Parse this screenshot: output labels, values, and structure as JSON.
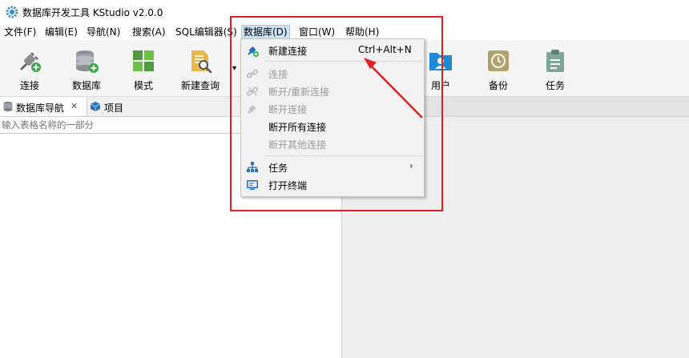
{
  "window": {
    "title": "数据库开发工具 KStudio v2.0.0"
  },
  "menubar": {
    "items": [
      {
        "label": "文件(F)"
      },
      {
        "label": "编辑(E)"
      },
      {
        "label": "导航(N)"
      },
      {
        "label": "搜索(A)"
      },
      {
        "label": "SQL编辑器(S)"
      },
      {
        "label": "数据库(D)"
      },
      {
        "label": "窗口(W)"
      },
      {
        "label": "帮助(H)"
      }
    ],
    "active_index": 5
  },
  "toolbar": {
    "items": [
      {
        "label": "连接",
        "icon": "plug-add-icon"
      },
      {
        "label": "数据库",
        "icon": "database-add-icon"
      },
      {
        "label": "模式",
        "icon": "schema-blocks-icon"
      },
      {
        "label": "新建查询",
        "icon": "new-query-icon"
      },
      {
        "label": "用户",
        "icon": "user-folder-icon"
      },
      {
        "label": "备份",
        "icon": "backup-clock-icon"
      },
      {
        "label": "任务",
        "icon": "task-clipboard-icon"
      }
    ],
    "more_arrow": "▾"
  },
  "left_panel": {
    "tabs": [
      {
        "label": "数据库导航",
        "icon": "db-navigator-icon",
        "close": "✕"
      },
      {
        "label": "项目",
        "icon": "project-cube-icon"
      }
    ],
    "search": {
      "placeholder": "输入表格名称的一部分"
    }
  },
  "database_menu": {
    "items": [
      {
        "label": "新建连接",
        "accelerator": "Ctrl+Alt+N",
        "enabled": true,
        "icon": "new-connection-icon"
      },
      {
        "label": "连接",
        "enabled": false,
        "icon": "link-icon"
      },
      {
        "label": "断开/重新连接",
        "enabled": false,
        "icon": "reconnect-icon"
      },
      {
        "label": "断开连接",
        "enabled": false,
        "icon": "disconnect-icon"
      },
      {
        "label": "断开所有连接",
        "enabled": true
      },
      {
        "label": "断开其他连接",
        "enabled": false
      },
      {
        "label": "任务",
        "enabled": true,
        "icon": "task-icon",
        "submenu_arrow": "›"
      },
      {
        "label": "打开终端",
        "enabled": true,
        "icon": "terminal-icon"
      }
    ]
  },
  "colors": {
    "annotation": "#e02020",
    "menu_highlight": "#cce4f7",
    "toolbar_bg": "#f5f5f5"
  }
}
